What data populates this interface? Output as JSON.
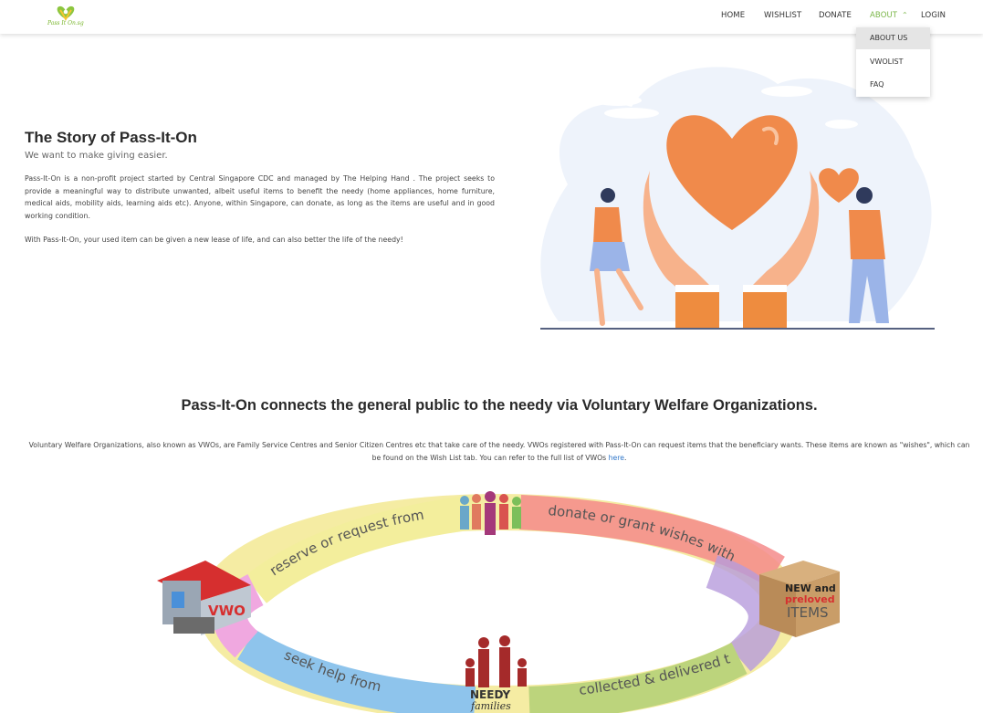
{
  "nav": {
    "logo_text": "Pass It On.sg",
    "items": [
      {
        "label": "HOME"
      },
      {
        "label": "WISHLIST"
      },
      {
        "label": "DONATE"
      },
      {
        "label": "ABOUT"
      },
      {
        "label": "LOGIN"
      }
    ],
    "dropdown": [
      {
        "label": "ABOUT US"
      },
      {
        "label": "VWOLIST"
      },
      {
        "label": "FAQ"
      }
    ]
  },
  "story": {
    "title": "The Story of Pass-It-On",
    "subtitle": "We want to make giving easier.",
    "paragraph1": "Pass-It-On is a non-profit project started by Central Singapore CDC and managed by The Helping Hand . The project seeks to provide a meaningful way to distribute unwanted, albeit useful items to benefit the needy (home appliances, home furniture, medical aids, mobility aids, learning aids etc). Anyone, within Singapore, can donate, as long as the items are useful and in good working condition.",
    "paragraph2": "With Pass-It-On, your used item can be given a new lease of life, and can also better the life of the needy!"
  },
  "connects": {
    "title": "Pass-It-On connects the general public to the needy via Voluntary Welfare Organizations.",
    "text": "Voluntary Welfare Organizations, also known as VWOs, are Family Service Centres and Senior Citizen Centres etc that take care of the needy. VWOs registered with Pass-It-On can request items that the beneficiary wants. These items are known as \"wishes\", which can be found on the Wish List tab. You can refer to the full list of VWOs",
    "link_text": "here",
    "text_end": "."
  },
  "cycle": {
    "labels": {
      "reserve": "reserve or request from",
      "donate": "donate or grant wishes with",
      "collected": "collected & delivered to",
      "seek": "seek help from"
    },
    "vwo": "VWO",
    "items_box": {
      "line1": "NEW and",
      "line2": "preloved",
      "line3": "ITEMS"
    },
    "needy": {
      "line1": "NEEDY",
      "line2": "families"
    }
  },
  "colors": {
    "accent": "#7ab648",
    "link": "#2e76c9",
    "heart": "#f08a4b"
  }
}
